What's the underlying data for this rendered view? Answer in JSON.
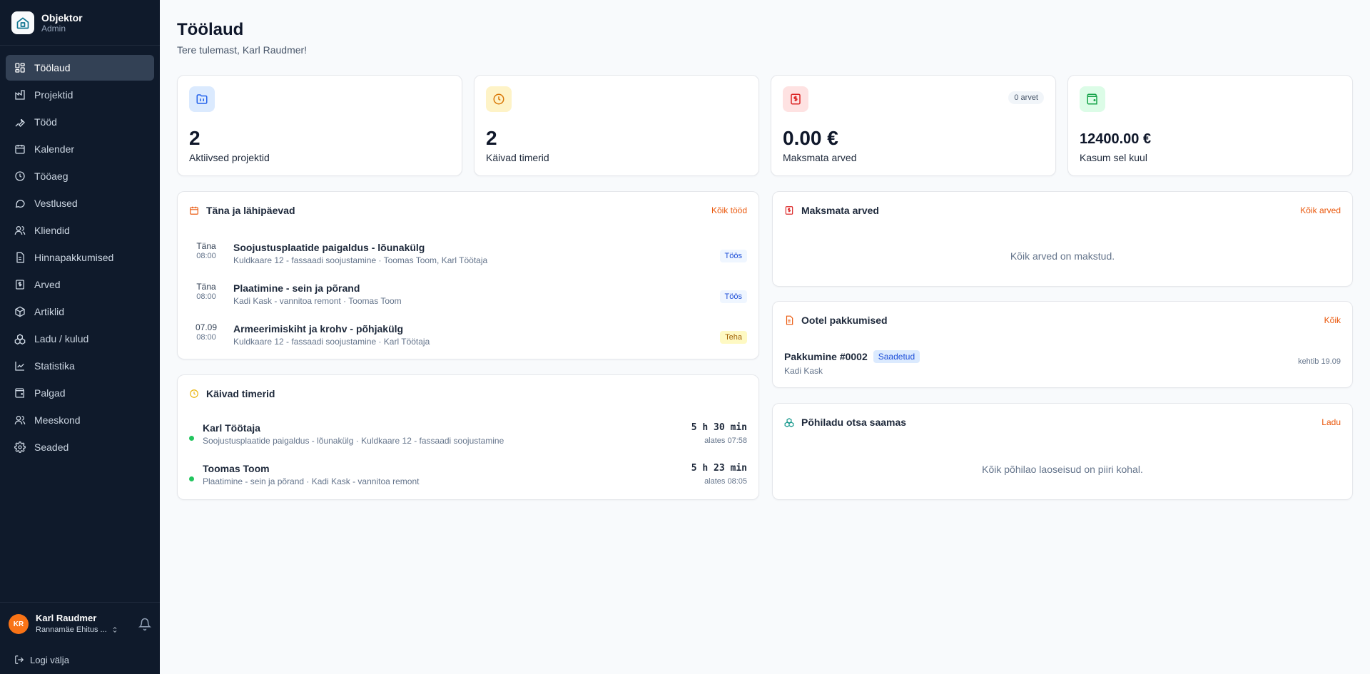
{
  "brand": {
    "name": "Objektor",
    "role": "Admin"
  },
  "nav": [
    {
      "label": "Töölaud",
      "icon": "dashboard-icon",
      "active": true
    },
    {
      "label": "Projektid",
      "icon": "projects-icon"
    },
    {
      "label": "Tööd",
      "icon": "wrench-icon"
    },
    {
      "label": "Kalender",
      "icon": "calendar-icon"
    },
    {
      "label": "Tööaeg",
      "icon": "clock-icon"
    },
    {
      "label": "Vestlused",
      "icon": "chat-icon"
    },
    {
      "label": "Kliendid",
      "icon": "users-icon"
    },
    {
      "label": "Hinnapakkumised",
      "icon": "document-icon"
    },
    {
      "label": "Arved",
      "icon": "invoice-icon"
    },
    {
      "label": "Artiklid",
      "icon": "box-icon"
    },
    {
      "label": "Ladu / kulud",
      "icon": "boxes-icon"
    },
    {
      "label": "Statistika",
      "icon": "chart-icon"
    },
    {
      "label": "Palgad",
      "icon": "wallet-icon"
    },
    {
      "label": "Meeskond",
      "icon": "team-icon"
    },
    {
      "label": "Seaded",
      "icon": "gear-icon"
    }
  ],
  "user": {
    "initials": "KR",
    "name": "Karl Raudmer",
    "company": "Rannamäe Ehitus ..."
  },
  "logout_label": "Logi välja",
  "page": {
    "title": "Töölaud",
    "subtitle": "Tere tulemast, Karl Raudmer!"
  },
  "stats": {
    "projects": {
      "value": "2",
      "label": "Aktiivsed projektid"
    },
    "timers": {
      "value": "2",
      "label": "Käivad timerid"
    },
    "unpaid": {
      "value": "0.00 €",
      "label": "Maksmata arved",
      "badge": "0 arvet"
    },
    "profit": {
      "value": "12400.00 €",
      "label": "Kasum sel kuul"
    }
  },
  "jobs_card": {
    "title": "Täna ja lähipäevad",
    "link": "Kõik tööd",
    "items": [
      {
        "day": "Täna",
        "time": "08:00",
        "title": "Soojustusplaatide paigaldus - lõunakülg",
        "sub": "Kuldkaare 12 - fassaadi soojustamine · Toomas Toom, Karl Töötaja",
        "status": "Töös",
        "status_color": "blue"
      },
      {
        "day": "Täna",
        "time": "08:00",
        "title": "Plaatimine - sein ja põrand",
        "sub": "Kadi Kask - vannitoa remont · Toomas Toom",
        "status": "Töös",
        "status_color": "blue"
      },
      {
        "day": "07.09",
        "time": "08:00",
        "title": "Armeerimiskiht ja krohv - põhjakülg",
        "sub": "Kuldkaare 12 - fassaadi soojustamine · Karl Töötaja",
        "status": "Teha",
        "status_color": "yellow"
      }
    ]
  },
  "timers_card": {
    "title": "Käivad timerid",
    "items": [
      {
        "name": "Karl Töötaja",
        "sub": "Soojustusplaatide paigaldus - lõunakülg · Kuldkaare 12 - fassaadi soojustamine",
        "duration": "5 h 30 min",
        "since": "alates 07:58"
      },
      {
        "name": "Toomas Toom",
        "sub": "Plaatimine - sein ja põrand · Kadi Kask - vannitoa remont",
        "duration": "5 h 23 min",
        "since": "alates 08:05"
      }
    ]
  },
  "invoices_card": {
    "title": "Maksmata arved",
    "link": "Kõik arved",
    "empty": "Kõik arved on makstud."
  },
  "offers_card": {
    "title": "Ootel pakkumised",
    "link": "Kõik",
    "item": {
      "title": "Pakkumine #0002",
      "status": "Saadetud",
      "client": "Kadi Kask",
      "valid": "kehtib 19.09"
    }
  },
  "stock_card": {
    "title": "Põhiladu otsa saamas",
    "link": "Ladu",
    "empty": "Kõik põhilao laoseisud on piiri kohal."
  },
  "colors": {
    "accent": "#ea580c",
    "sidebar_bg": "#0f1a2b",
    "timer_dot": "#22c55e"
  }
}
